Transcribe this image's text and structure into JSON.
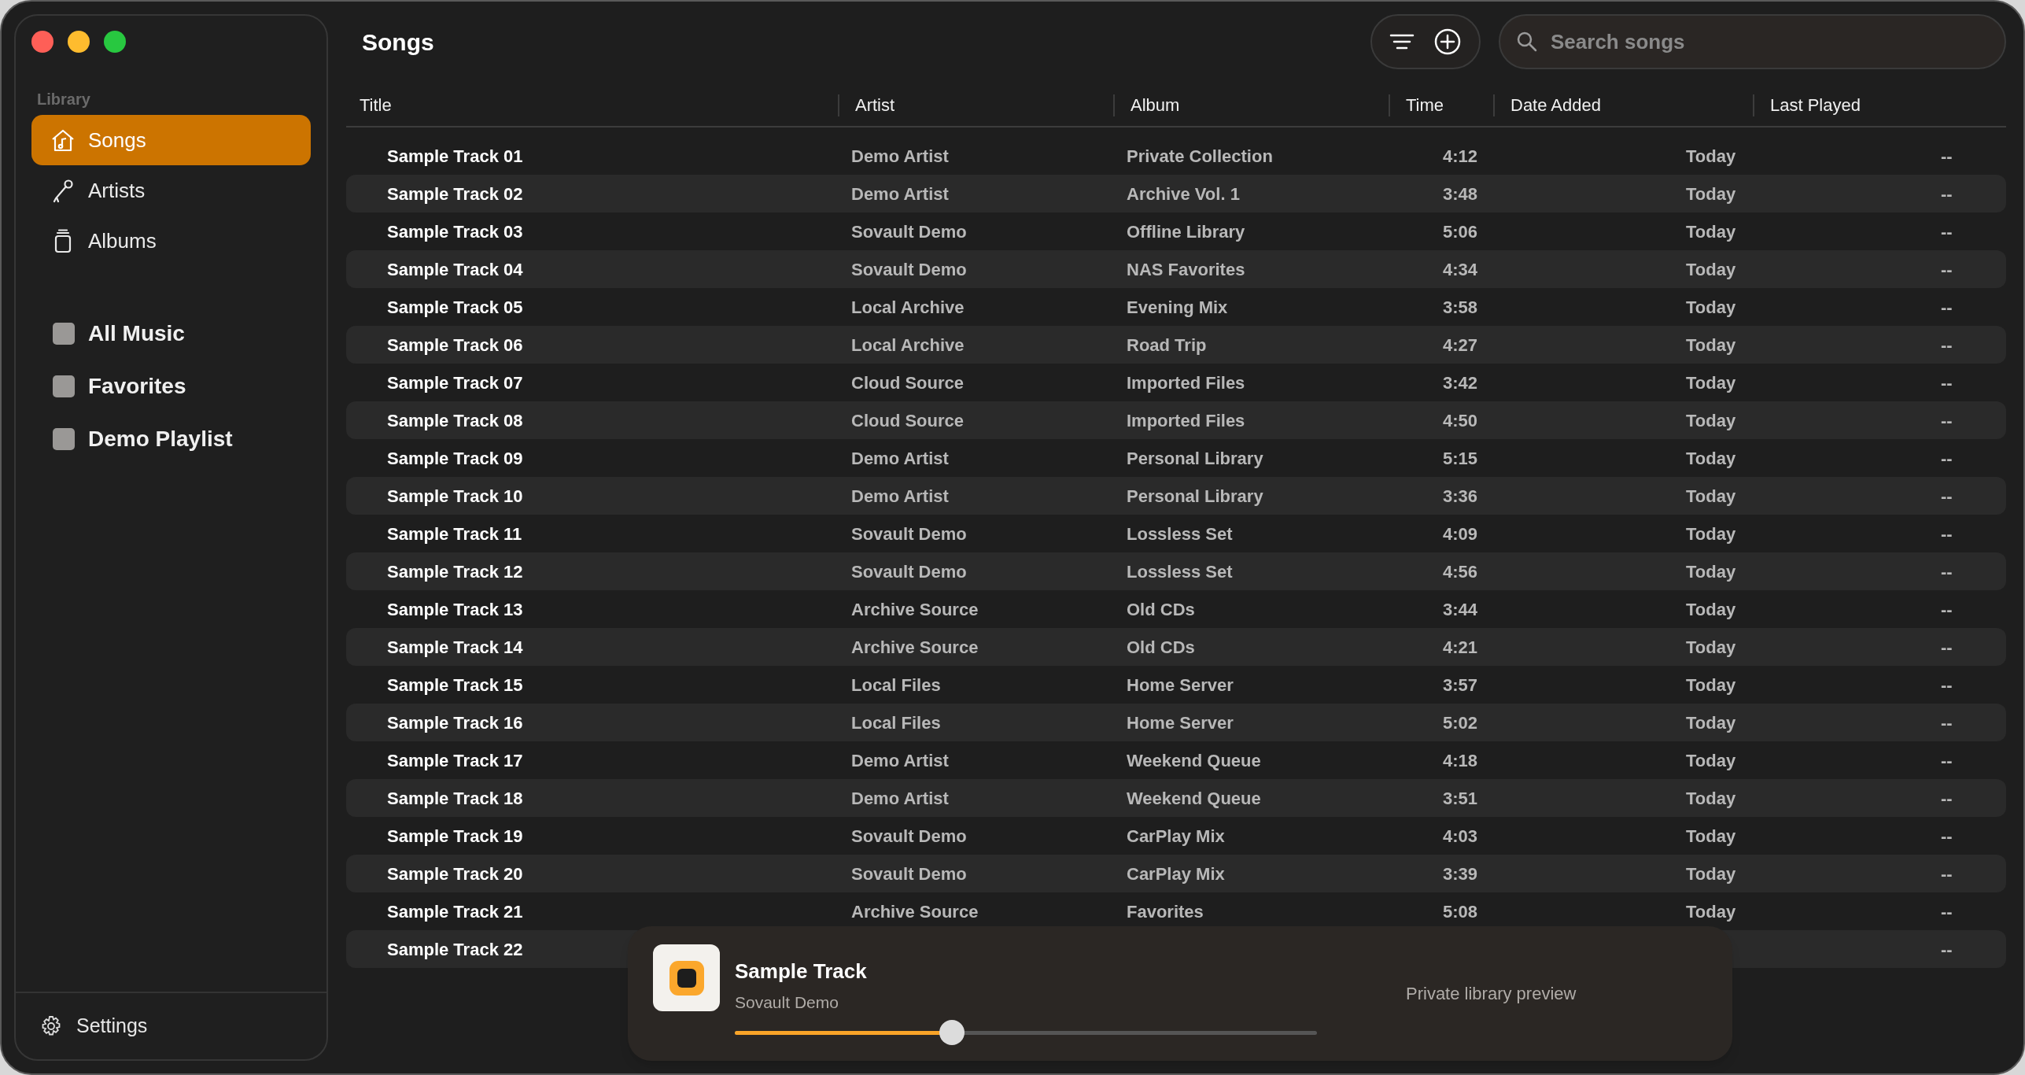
{
  "sidebar": {
    "section_label": "Library",
    "items": [
      {
        "label": "Songs",
        "selected": true
      },
      {
        "label": "Artists",
        "selected": false
      },
      {
        "label": "Albums",
        "selected": false
      }
    ],
    "playlists": [
      {
        "label": "All Music"
      },
      {
        "label": "Favorites"
      },
      {
        "label": "Demo Playlist"
      }
    ],
    "settings": {
      "label": "Settings"
    }
  },
  "main": {
    "title": "Songs",
    "search": {
      "placeholder": "Search songs"
    }
  },
  "table": {
    "columns": [
      "Title",
      "Artist",
      "Album",
      "Time",
      "Date Added",
      "Last Played"
    ],
    "rows": [
      {
        "title": "Sample Track 01",
        "artist": "Demo Artist",
        "album": "Private Collection",
        "time": "4:12",
        "date_added": "Today",
        "last_played": "--"
      },
      {
        "title": "Sample Track 02",
        "artist": "Demo Artist",
        "album": "Archive Vol. 1",
        "time": "3:48",
        "date_added": "Today",
        "last_played": "--"
      },
      {
        "title": "Sample Track 03",
        "artist": "Sovault Demo",
        "album": "Offline Library",
        "time": "5:06",
        "date_added": "Today",
        "last_played": "--"
      },
      {
        "title": "Sample Track 04",
        "artist": "Sovault Demo",
        "album": "NAS Favorites",
        "time": "4:34",
        "date_added": "Today",
        "last_played": "--"
      },
      {
        "title": "Sample Track 05",
        "artist": "Local Archive",
        "album": "Evening Mix",
        "time": "3:58",
        "date_added": "Today",
        "last_played": "--"
      },
      {
        "title": "Sample Track 06",
        "artist": "Local Archive",
        "album": "Road Trip",
        "time": "4:27",
        "date_added": "Today",
        "last_played": "--"
      },
      {
        "title": "Sample Track 07",
        "artist": "Cloud Source",
        "album": "Imported Files",
        "time": "3:42",
        "date_added": "Today",
        "last_played": "--"
      },
      {
        "title": "Sample Track 08",
        "artist": "Cloud Source",
        "album": "Imported Files",
        "time": "4:50",
        "date_added": "Today",
        "last_played": "--"
      },
      {
        "title": "Sample Track 09",
        "artist": "Demo Artist",
        "album": "Personal Library",
        "time": "5:15",
        "date_added": "Today",
        "last_played": "--"
      },
      {
        "title": "Sample Track 10",
        "artist": "Demo Artist",
        "album": "Personal Library",
        "time": "3:36",
        "date_added": "Today",
        "last_played": "--"
      },
      {
        "title": "Sample Track 11",
        "artist": "Sovault Demo",
        "album": "Lossless Set",
        "time": "4:09",
        "date_added": "Today",
        "last_played": "--"
      },
      {
        "title": "Sample Track 12",
        "artist": "Sovault Demo",
        "album": "Lossless Set",
        "time": "4:56",
        "date_added": "Today",
        "last_played": "--"
      },
      {
        "title": "Sample Track 13",
        "artist": "Archive Source",
        "album": "Old CDs",
        "time": "3:44",
        "date_added": "Today",
        "last_played": "--"
      },
      {
        "title": "Sample Track 14",
        "artist": "Archive Source",
        "album": "Old CDs",
        "time": "4:21",
        "date_added": "Today",
        "last_played": "--"
      },
      {
        "title": "Sample Track 15",
        "artist": "Local Files",
        "album": "Home Server",
        "time": "3:57",
        "date_added": "Today",
        "last_played": "--"
      },
      {
        "title": "Sample Track 16",
        "artist": "Local Files",
        "album": "Home Server",
        "time": "5:02",
        "date_added": "Today",
        "last_played": "--"
      },
      {
        "title": "Sample Track 17",
        "artist": "Demo Artist",
        "album": "Weekend Queue",
        "time": "4:18",
        "date_added": "Today",
        "last_played": "--"
      },
      {
        "title": "Sample Track 18",
        "artist": "Demo Artist",
        "album": "Weekend Queue",
        "time": "3:51",
        "date_added": "Today",
        "last_played": "--"
      },
      {
        "title": "Sample Track 19",
        "artist": "Sovault Demo",
        "album": "CarPlay Mix",
        "time": "4:03",
        "date_added": "Today",
        "last_played": "--"
      },
      {
        "title": "Sample Track 20",
        "artist": "Sovault Demo",
        "album": "CarPlay Mix",
        "time": "3:39",
        "date_added": "Today",
        "last_played": "--"
      },
      {
        "title": "Sample Track 21",
        "artist": "Archive Source",
        "album": "Favorites",
        "time": "5:08",
        "date_added": "Today",
        "last_played": "--"
      },
      {
        "title": "Sample Track 22",
        "last_played": "--"
      }
    ]
  },
  "player": {
    "title": "Sample Track",
    "artist": "Sovault Demo",
    "level": 0.373,
    "note": "Private library preview"
  }
}
